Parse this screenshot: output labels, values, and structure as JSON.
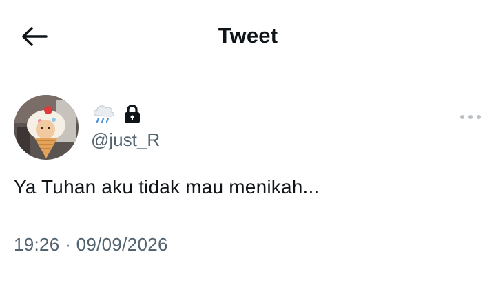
{
  "header": {
    "back_icon": "arrow-left-icon",
    "title": "Tweet"
  },
  "tweet": {
    "display_name_icons": [
      "rain-cloud-emoji-icon",
      "lock-icon"
    ],
    "handle": "@just_R",
    "text": "Ya Tuhan aku tidak mau menikah...",
    "time": "19:26",
    "separator": "·",
    "date": "09/09/2026",
    "more_icon": "more-dots-icon"
  },
  "colors": {
    "primary_text": "#0f1419",
    "secondary_text": "#536471",
    "background": "#ffffff"
  }
}
